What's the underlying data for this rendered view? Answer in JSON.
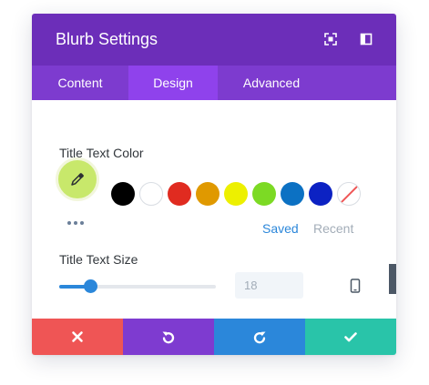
{
  "header": {
    "title": "Blurb Settings",
    "color": "#6c2eb9"
  },
  "tabs": [
    {
      "label": "Content",
      "active": false
    },
    {
      "label": "Design",
      "active": true
    },
    {
      "label": "Advanced",
      "active": false
    }
  ],
  "title_color": {
    "label": "Title Text Color",
    "current_color": "#c8e86b",
    "swatches": [
      {
        "name": "black",
        "color": "#000000"
      },
      {
        "name": "white",
        "color": "#ffffff"
      },
      {
        "name": "red",
        "color": "#e02b20"
      },
      {
        "name": "orange",
        "color": "#e09900"
      },
      {
        "name": "yellow",
        "color": "#edf000"
      },
      {
        "name": "green",
        "color": "#7cda24"
      },
      {
        "name": "blue",
        "color": "#0c71c3"
      },
      {
        "name": "dark-blue",
        "color": "#0c22c3"
      },
      {
        "name": "none",
        "color": "transparent"
      }
    ],
    "saved_label": "Saved",
    "recent_label": "Recent",
    "active_set": "Saved"
  },
  "title_size": {
    "label": "Title Text Size",
    "value": "18",
    "slider_fraction": 0.2,
    "accent_color": "#2b87da"
  },
  "footer": {
    "buttons": [
      {
        "name": "discard",
        "icon": "close-icon",
        "color": "#ef5555"
      },
      {
        "name": "undo",
        "icon": "undo-icon",
        "color": "#7e3bd0"
      },
      {
        "name": "redo",
        "icon": "redo-icon",
        "color": "#2b87da"
      },
      {
        "name": "save",
        "icon": "check-icon",
        "color": "#29c4a9"
      }
    ]
  }
}
